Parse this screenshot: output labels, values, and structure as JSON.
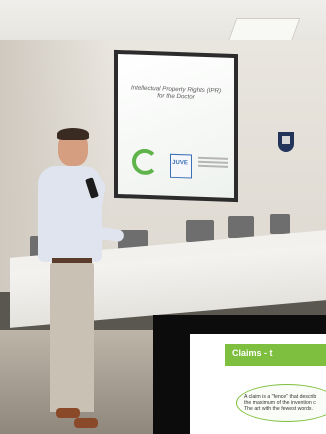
{
  "projected_slide": {
    "title": "Intellectual Property Rights (IPR) for the Doctor",
    "logo_text": "JUVE"
  },
  "inset_slide": {
    "title": "Claims - t",
    "line1": "A claim is a \"fence\" that describ",
    "line2": "the maximum of the invention c",
    "line3": "The art with the fewest words."
  }
}
